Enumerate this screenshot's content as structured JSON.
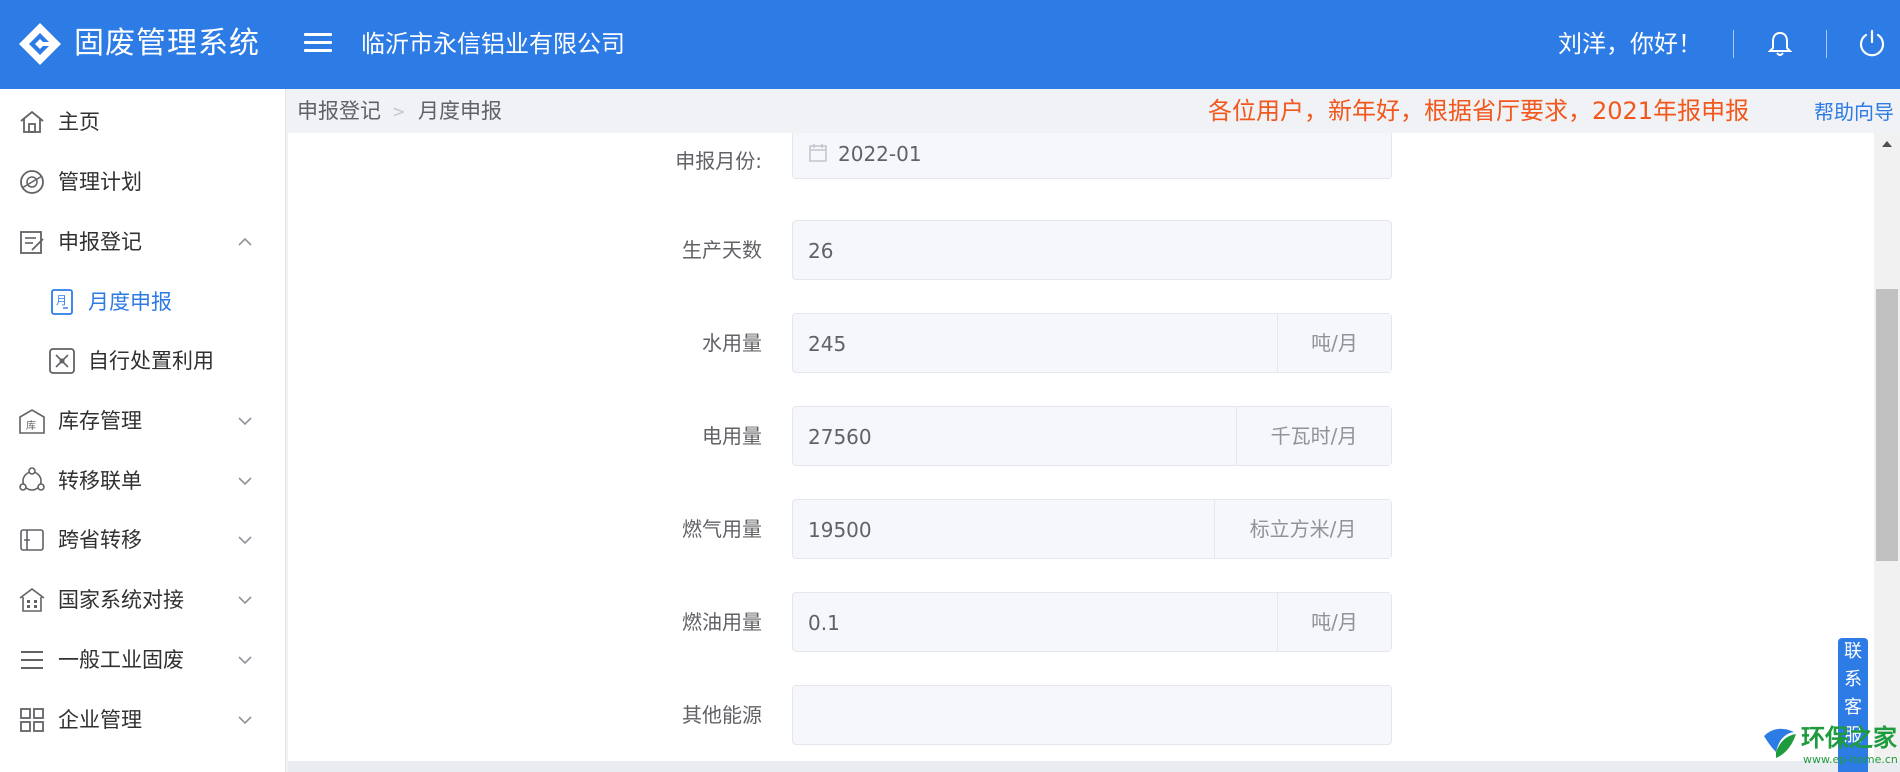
{
  "header": {
    "app_title": "固废管理系统",
    "company": "临沂市永信铝业有限公司",
    "greeting": "刘洋，你好！",
    "icons": [
      "logo-icon",
      "menu-icon",
      "bell-icon",
      "power-icon"
    ]
  },
  "sidebar": {
    "items": [
      {
        "label": "主页",
        "icon": "home-icon"
      },
      {
        "label": "管理计划",
        "icon": "plan-icon"
      },
      {
        "label": "申报登记",
        "icon": "register-icon",
        "expanded": true
      },
      {
        "label": "月度申报",
        "icon": "monthly-icon",
        "active": true
      },
      {
        "label": "自行处置利用",
        "icon": "dispose-icon"
      },
      {
        "label": "库存管理",
        "icon": "warehouse-icon"
      },
      {
        "label": "转移联单",
        "icon": "transfer-icon"
      },
      {
        "label": "跨省转移",
        "icon": "cross-province-icon"
      },
      {
        "label": "国家系统对接",
        "icon": "national-icon"
      },
      {
        "label": "一般工业固废",
        "icon": "list-icon"
      },
      {
        "label": "企业管理",
        "icon": "grid-icon"
      }
    ]
  },
  "breadcrumb": {
    "items": [
      "申报登记",
      "月度申报"
    ],
    "separator": ">"
  },
  "notice": "各位用户，新年好，根据省厅要求，2021年报申报",
  "help_label": "帮助向导",
  "form": {
    "rows": [
      {
        "label": "申报月份:",
        "value": "2022-01",
        "unit": ""
      },
      {
        "label": "生产天数",
        "value": "26",
        "unit": ""
      },
      {
        "label": "水用量",
        "value": "245",
        "unit": "吨/月"
      },
      {
        "label": "电用量",
        "value": "27560",
        "unit": "千瓦时/月"
      },
      {
        "label": "燃气用量",
        "value": "19500",
        "unit": "标立方米/月"
      },
      {
        "label": "燃油用量",
        "value": "0.1",
        "unit": "吨/月"
      },
      {
        "label": "其他能源",
        "value": "",
        "unit": ""
      }
    ]
  },
  "customer_service": {
    "label_chars": [
      "联",
      "系",
      "客",
      "服"
    ]
  },
  "watermark": {
    "text": "环保之家",
    "url_text": "www.ep-home.cn"
  },
  "colors": {
    "brand": "#2d7be5",
    "notice": "#f2571b",
    "active": "#2d7be5"
  }
}
